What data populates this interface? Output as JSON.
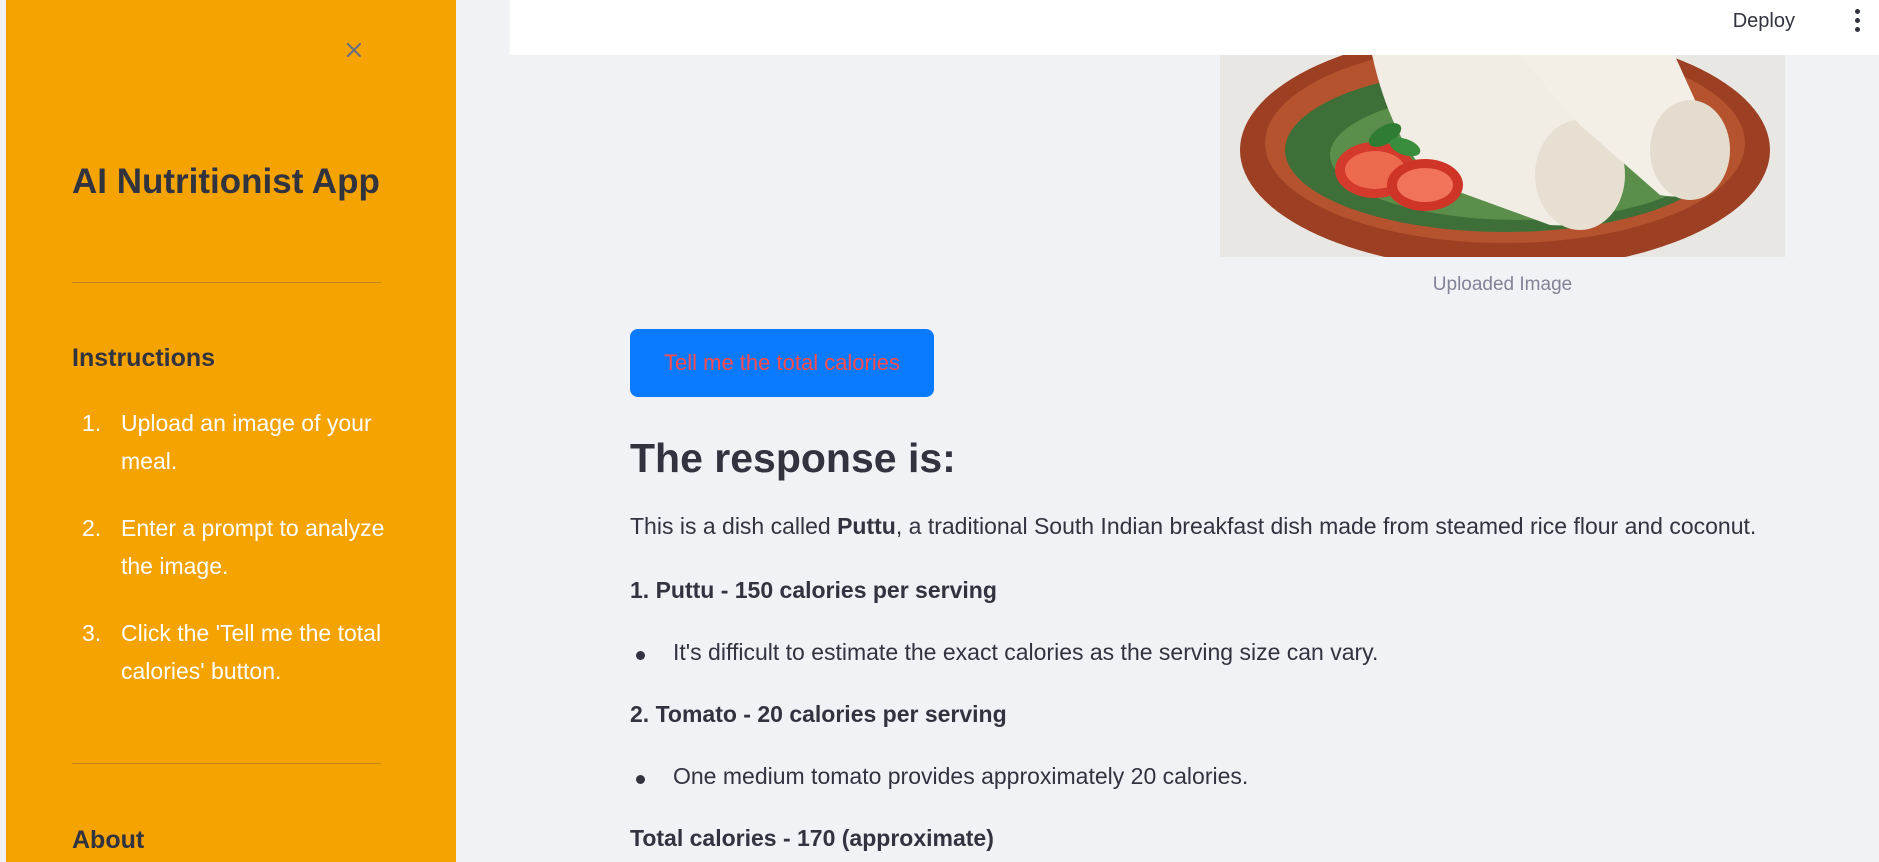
{
  "sidebar": {
    "title": "AI Nutritionist App",
    "instructions_heading": "Instructions",
    "steps": [
      {
        "num": "1.",
        "text": "Upload an image of your meal."
      },
      {
        "num": "2.",
        "text": "Enter a prompt to analyze the image."
      },
      {
        "num": "3.",
        "text": "Click the 'Tell me the total calories' button."
      }
    ],
    "about_heading": "About",
    "background_color": "#f5a300",
    "close_icon": "close-icon"
  },
  "header": {
    "deploy_label": "Deploy",
    "menu_icon": "kebab-menu-icon"
  },
  "main": {
    "image_caption": "Uploaded Image",
    "calculate_button_label": "Tell me the total calories",
    "button_color": "#0a7bff",
    "button_text_color": "#ff4b4b",
    "response_title": "The response is:",
    "intro_prefix": "This is a dish called ",
    "intro_dish": "Puttu",
    "intro_suffix": ", a traditional South Indian breakfast dish made from steamed rice flour and coconut.",
    "item1_heading": "1. Puttu - 150 calories per serving",
    "item1_note": "It's difficult to estimate the exact calories as the serving size can vary.",
    "item2_heading": "2. Tomato - 20 calories per serving",
    "item2_note": "One medium tomato provides approximately 20 calories.",
    "total": "Total calories - 170 (approximate)"
  }
}
